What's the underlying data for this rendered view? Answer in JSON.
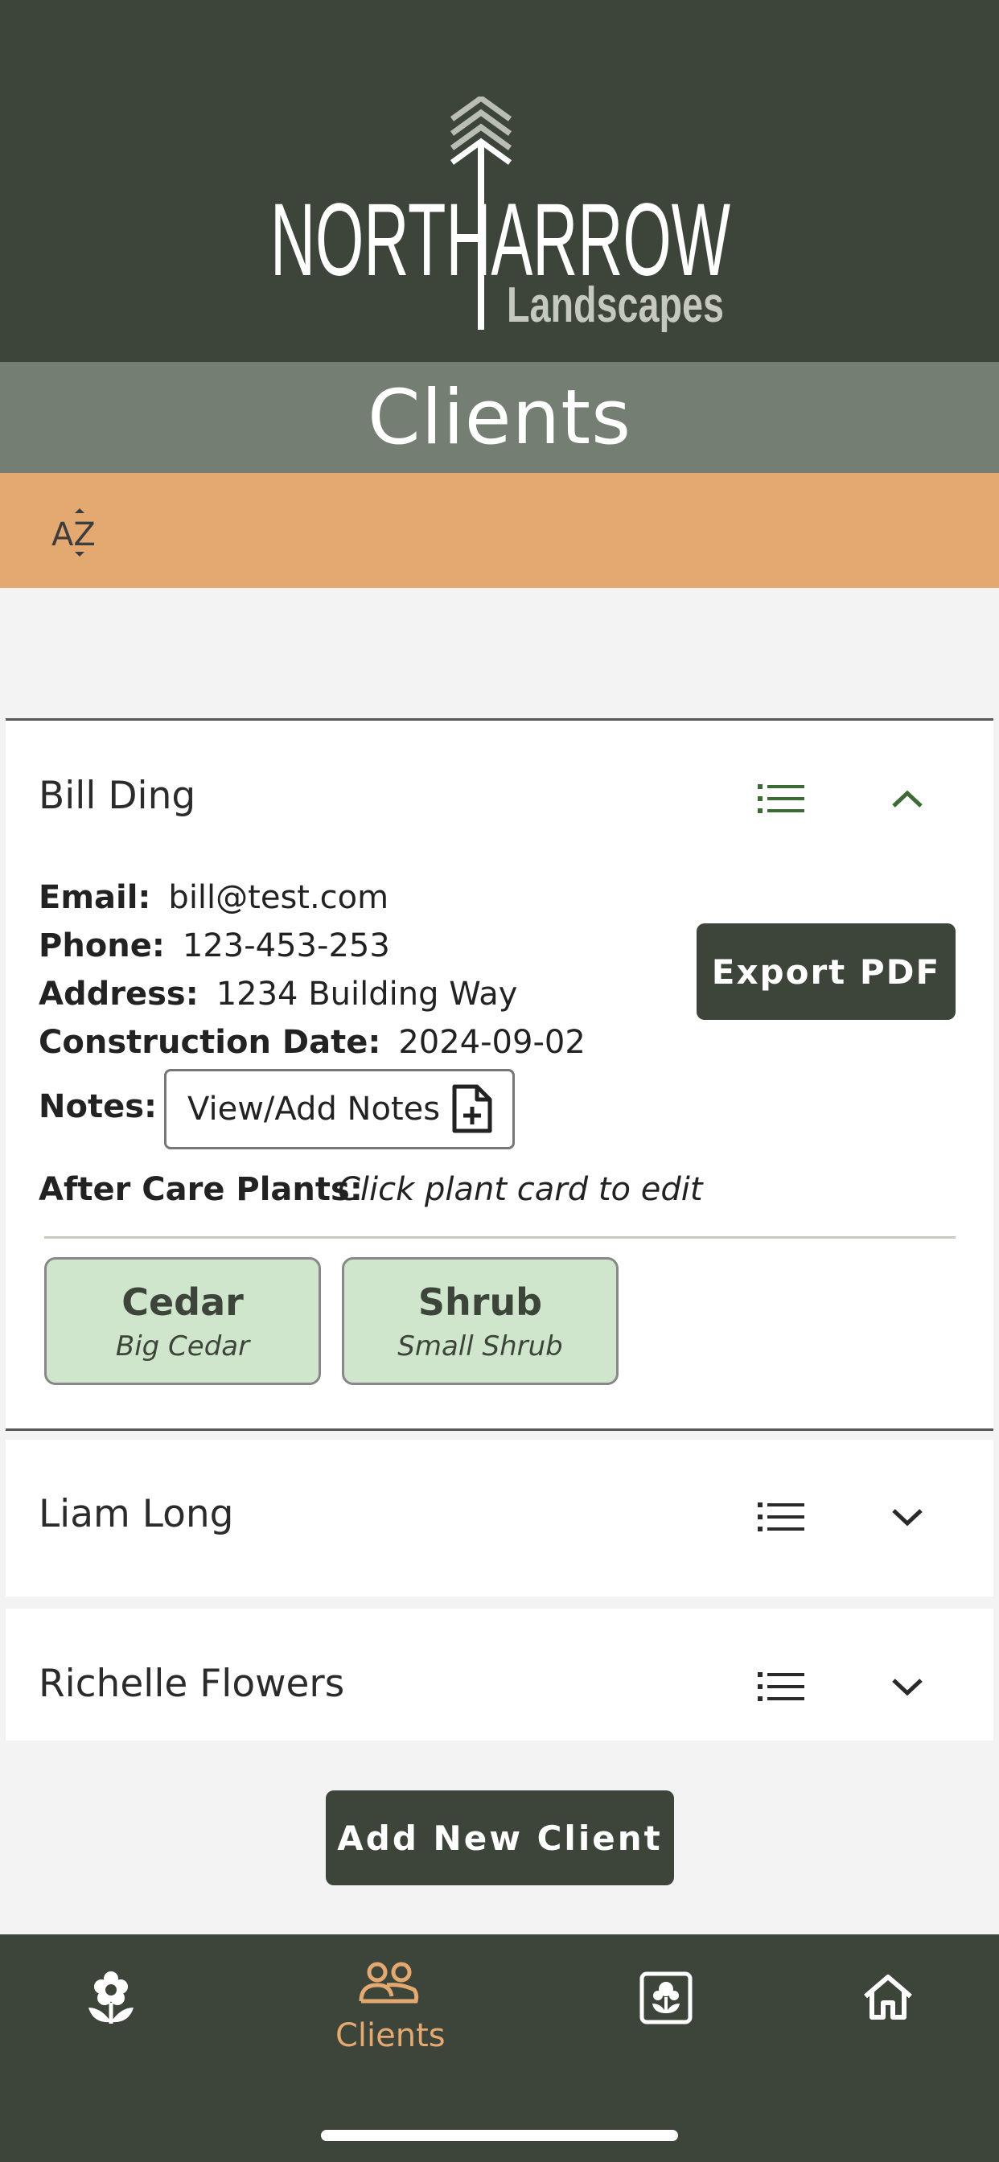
{
  "header": {
    "logo_main": "NORTHARROW",
    "logo_sub": "Landscapes"
  },
  "page": {
    "title": "Clients"
  },
  "sort": {
    "icon": "sort-az-icon",
    "label": "AZ"
  },
  "clients": [
    {
      "name": "Bill Ding",
      "expanded": true,
      "email_label": "Email:",
      "email": "bill@test.com",
      "phone_label": "Phone:",
      "phone": "123-453-253",
      "address_label": "Address:",
      "address": "1234 Building Way",
      "construction_label": "Construction Date:",
      "construction_date": "2024-09-02",
      "notes_label": "Notes:",
      "notes_button": "View/Add Notes",
      "aftercare_label": "After Care Plants:",
      "aftercare_hint": "Click plant card to edit",
      "plants": [
        {
          "name": "Cedar",
          "variety": "Big Cedar"
        },
        {
          "name": "Shrub",
          "variety": "Small Shrub"
        }
      ],
      "export_label": "Export PDF"
    },
    {
      "name": "Liam Long",
      "expanded": false
    },
    {
      "name": "Richelle Flowers",
      "expanded": false
    }
  ],
  "actions": {
    "add_client": "Add New Client"
  },
  "tabs": [
    {
      "icon": "flower-icon",
      "label": ""
    },
    {
      "icon": "users-icon",
      "label": "Clients",
      "active": true
    },
    {
      "icon": "plant-card-icon",
      "label": ""
    },
    {
      "icon": "home-icon",
      "label": ""
    }
  ],
  "colors": {
    "dark": "#3d453b",
    "title_bar": "#747e72",
    "accent": "#e3a970",
    "plant_card": "#cfe6cc",
    "icon_green": "#3d6b35"
  }
}
